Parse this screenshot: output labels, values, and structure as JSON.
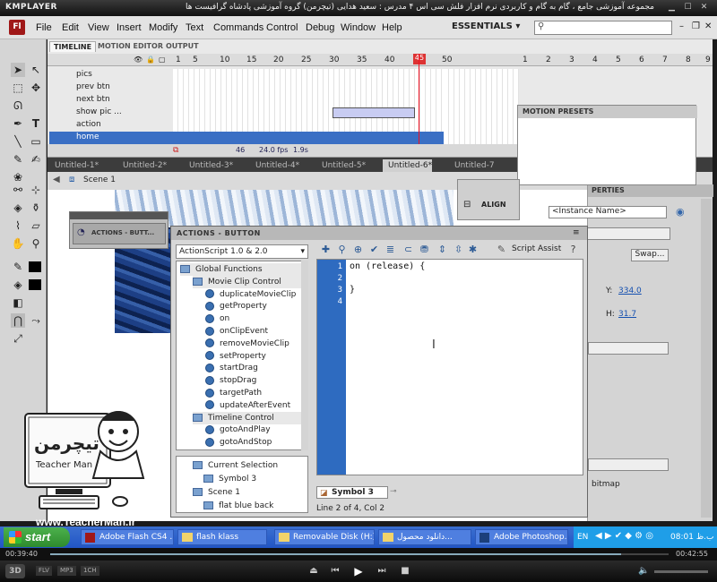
{
  "player": {
    "logo": "KMPLAYER",
    "title": "مجموعه آموزشی جامع ، گام به گام و کاربردی نرم افزار فلش سی اس ۴ مدرس : سعید هدایی (تیچرمن) گروه آموزشی پادشاه گرافیست ها",
    "time_elapsed": "00:39:40",
    "time_total": "00:42:55",
    "badges": [
      "FLV",
      "MP3",
      "1CH"
    ],
    "logo_3d": "3D"
  },
  "app": {
    "logo_text": "Fl",
    "menus": [
      "File",
      "Edit",
      "View",
      "Insert",
      "Modify",
      "Text",
      "Commands",
      "Control",
      "Debug",
      "Window",
      "Help"
    ],
    "workspace": "ESSENTIALS",
    "search_placeholder": ""
  },
  "timeline": {
    "tabs": [
      "TIMELINE",
      "MOTION EDITOR",
      "OUTPUT"
    ],
    "frame_ruler": [
      "1",
      "5",
      "10",
      "15",
      "20",
      "25",
      "30",
      "35",
      "40",
      "45",
      "50"
    ],
    "right_ruler": [
      "1",
      "2",
      "3",
      "4",
      "5",
      "6",
      "7",
      "8",
      "9"
    ],
    "layers": [
      "pics",
      "prev btn",
      "next btn",
      "show pic ...",
      "action",
      "home"
    ],
    "selected_layer": "home",
    "current_frame": "46",
    "fps": "24.0 fps",
    "elapsed": "1.9s"
  },
  "doc_tabs": [
    "Untitled-1*",
    "Untitled-2*",
    "Untitled-3*",
    "Untitled-4*",
    "Untitled-5*",
    "Untitled-6*",
    "Untitled-7"
  ],
  "scene": "Scene 1",
  "panels": {
    "motion_presets": "MOTION PRESETS",
    "align": "ALIGN",
    "properties": "PERTIES",
    "instance_name_placeholder": "<Instance Name>",
    "swap": "Swap...",
    "y_label": "Y:",
    "y_value": "334.0",
    "h_label": "H:",
    "h_value": "31.7",
    "bitmap": "bitmap",
    "mini_actions": "ACTIONS - BUTT..."
  },
  "actions": {
    "header": "ACTIONS - BUTTON",
    "language": "ActionScript 1.0 & 2.0",
    "script_assist": "Script Assist",
    "tree": [
      {
        "label": "Global Functions",
        "kind": "folder",
        "indent": 0
      },
      {
        "label": "Movie Clip Control",
        "kind": "folder",
        "indent": 1
      },
      {
        "label": "duplicateMovieClip",
        "kind": "item",
        "indent": 2
      },
      {
        "label": "getProperty",
        "kind": "item",
        "indent": 2
      },
      {
        "label": "on",
        "kind": "item",
        "indent": 2
      },
      {
        "label": "onClipEvent",
        "kind": "item",
        "indent": 2
      },
      {
        "label": "removeMovieClip",
        "kind": "item",
        "indent": 2
      },
      {
        "label": "setProperty",
        "kind": "item",
        "indent": 2
      },
      {
        "label": "startDrag",
        "kind": "item",
        "indent": 2
      },
      {
        "label": "stopDrag",
        "kind": "item",
        "indent": 2
      },
      {
        "label": "targetPath",
        "kind": "item",
        "indent": 2
      },
      {
        "label": "updateAfterEvent",
        "kind": "item",
        "indent": 2
      },
      {
        "label": "Timeline Control",
        "kind": "folder",
        "indent": 1
      },
      {
        "label": "gotoAndPlay",
        "kind": "item",
        "indent": 2
      },
      {
        "label": "gotoAndStop",
        "kind": "item",
        "indent": 2
      }
    ],
    "tree2": [
      {
        "label": "Current Selection",
        "indent": 1
      },
      {
        "label": "Symbol 3",
        "indent": 2
      },
      {
        "label": "Scene 1",
        "indent": 1
      },
      {
        "label": "flat blue back",
        "indent": 2
      }
    ],
    "line_numbers": [
      "1",
      "2",
      "3",
      "4"
    ],
    "code_lines": [
      "on (release) {",
      "",
      "}",
      ""
    ],
    "symbol_tab": "Symbol 3",
    "status": "Line 2 of 4, Col 2"
  },
  "branding": {
    "logo_caption": "Teacher Man",
    "site": "www.TeacherMan.ir"
  },
  "taskbar": {
    "start": "start",
    "tasks": [
      "Adobe Flash CS4 ...",
      "flash klass",
      "Removable Disk (H:)",
      "دانلود محصول...",
      "Adobe Photoshop..."
    ],
    "lang": "EN",
    "clock": "08:01 ب.ظ"
  }
}
